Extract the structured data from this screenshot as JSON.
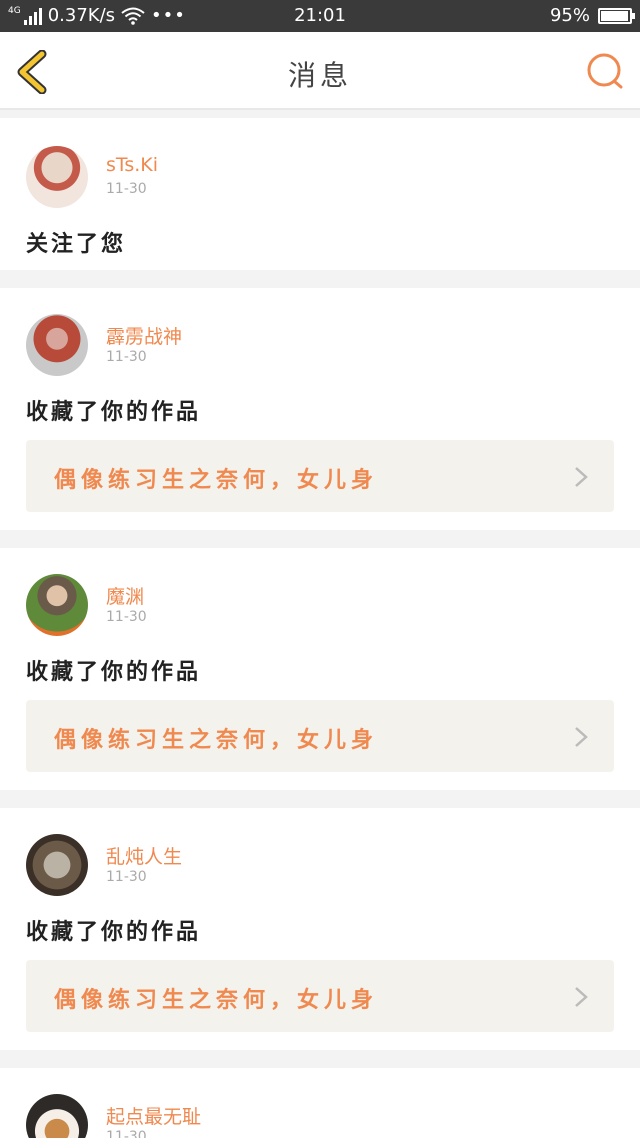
{
  "status_bar": {
    "network": "4G",
    "speed": "0.37K/s",
    "more": "•••",
    "time": "21:01",
    "battery": "95%",
    "battery_level": 0.95
  },
  "header": {
    "title": "消息",
    "back_icon": "chevron-left-icon",
    "search_icon": "search-icon",
    "accent_color": "#f0894f",
    "back_color": "#f2c531"
  },
  "notifications": [
    {
      "username": "sTs.Ki",
      "date": "11-30",
      "action": "关注了您"
    },
    {
      "username": "霹雳战神",
      "date": "11-30",
      "action": "收藏了你的作品",
      "work_title": "偶像练习生之奈何，女儿身"
    },
    {
      "username": "魔渊",
      "date": "11-30",
      "action": "收藏了你的作品",
      "work_title": "偶像练习生之奈何，女儿身"
    },
    {
      "username": "乱炖人生",
      "date": "11-30",
      "action": "收藏了你的作品",
      "work_title": "偶像练习生之奈何，女儿身"
    },
    {
      "username": "起点最无耻",
      "date": "11-30"
    }
  ]
}
